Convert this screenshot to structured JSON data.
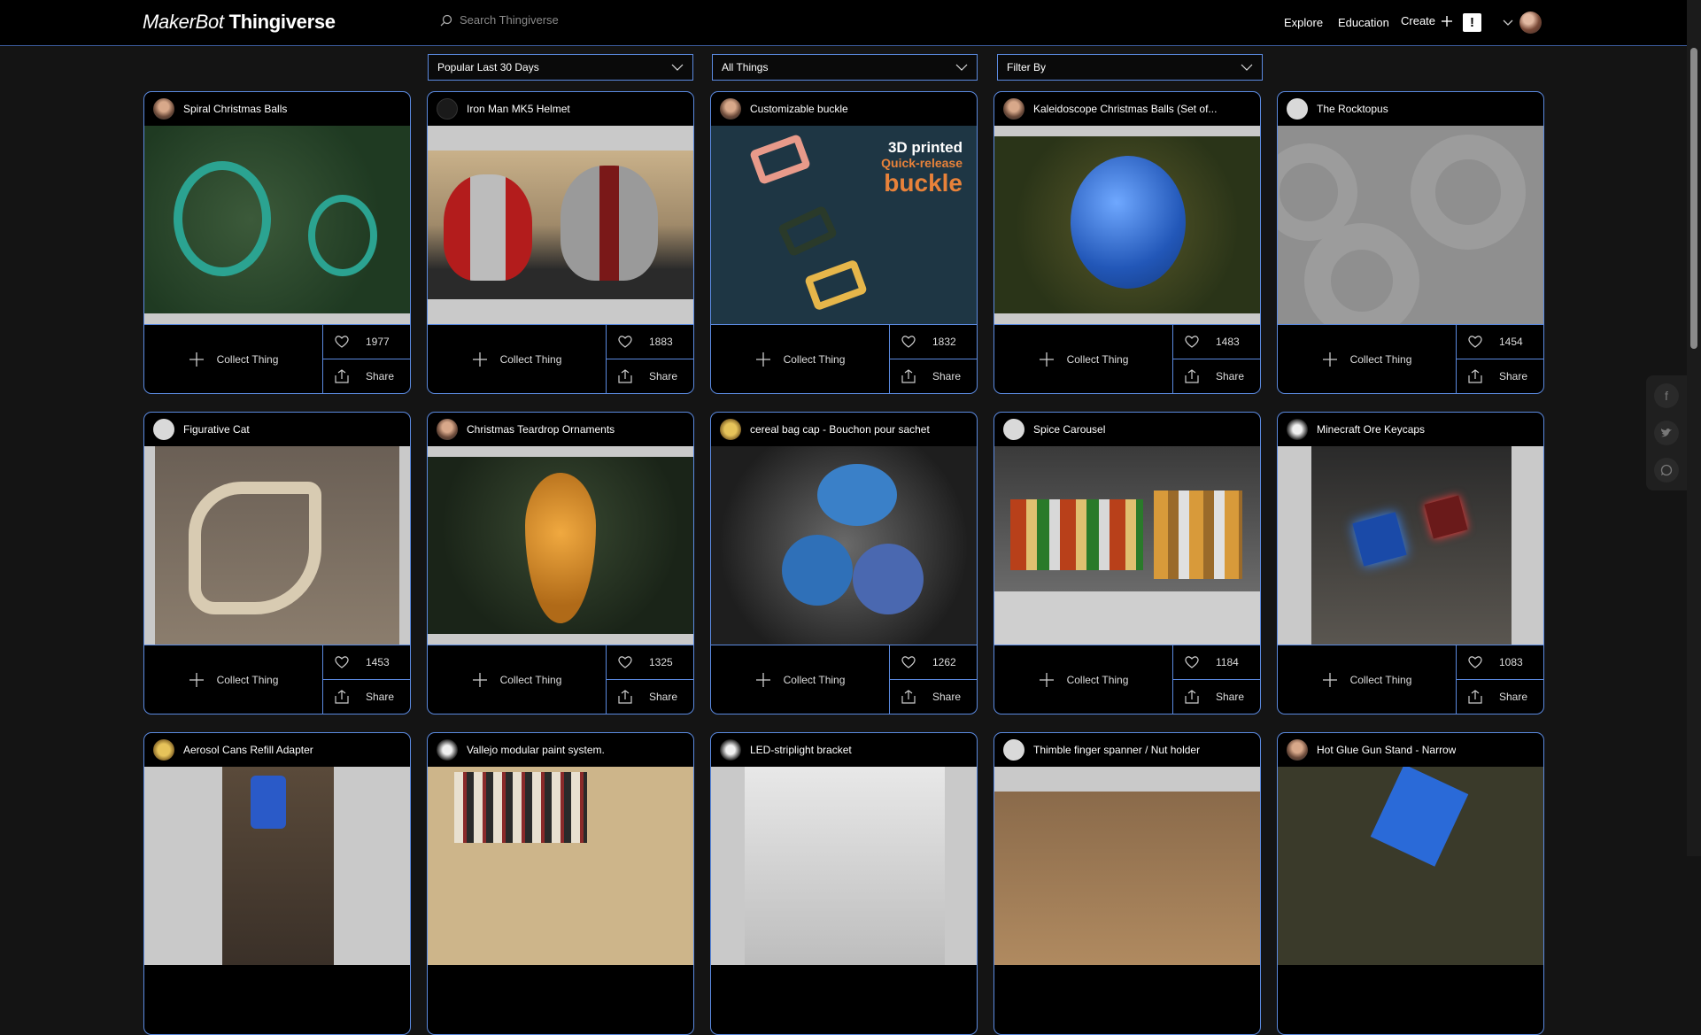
{
  "header": {
    "logo_prefix": "MakerBot",
    "logo_name": "Thingiverse",
    "search_placeholder": "Search Thingiverse",
    "nav": {
      "explore": "Explore",
      "education": "Education",
      "create": "Create"
    },
    "alert_label": "!"
  },
  "filters": {
    "sort": "Popular Last 30 Days",
    "type": "All Things",
    "filter_by": "Filter By"
  },
  "card_actions": {
    "collect": "Collect Thing",
    "share": "Share"
  },
  "cards": [
    {
      "title": "Spiral Christmas Balls",
      "likes": "1977"
    },
    {
      "title": "Iron Man MK5 Helmet",
      "likes": "1883"
    },
    {
      "title": "Customizable buckle",
      "likes": "1832",
      "image_text": [
        "3D printed",
        "Quick-release",
        "buckle"
      ]
    },
    {
      "title": "Kaleidoscope Christmas Balls (Set of...",
      "likes": "1483"
    },
    {
      "title": "The Rocktopus",
      "likes": "1454"
    },
    {
      "title": "Figurative Cat",
      "likes": "1453"
    },
    {
      "title": "Christmas Teardrop Ornaments",
      "likes": "1325"
    },
    {
      "title": "cereal bag cap - Bouchon pour sachet",
      "likes": "1262"
    },
    {
      "title": "Spice Carousel",
      "likes": "1184"
    },
    {
      "title": "Minecraft Ore Keycaps",
      "likes": "1083"
    },
    {
      "title": "Aerosol Cans Refill Adapter"
    },
    {
      "title": "Vallejo modular paint system."
    },
    {
      "title": "LED-striplight bracket"
    },
    {
      "title": "Thimble finger spanner / Nut holder"
    },
    {
      "title": "Hot Glue Gun Stand - Narrow"
    }
  ],
  "social": [
    "facebook-icon",
    "twitter-icon",
    "whatsapp-icon"
  ],
  "colors": {
    "accent_border": "#5b8ae0",
    "background": "#141414",
    "header": "#000000"
  }
}
